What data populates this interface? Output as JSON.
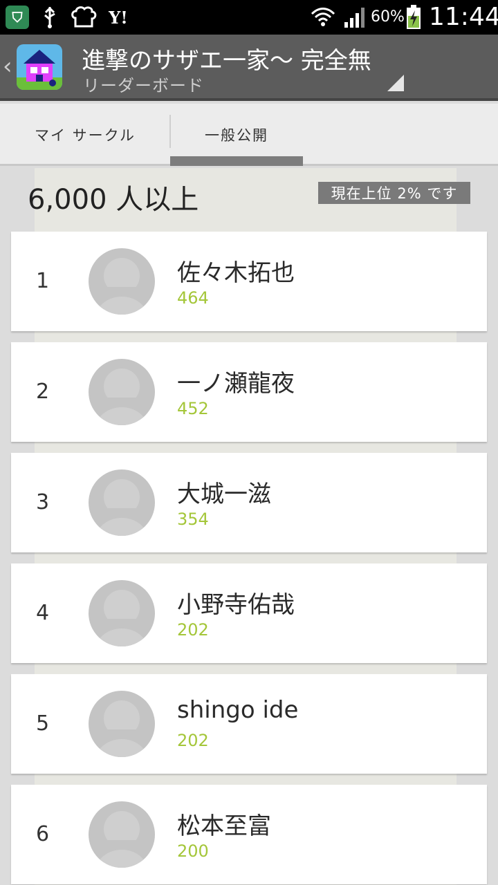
{
  "status_bar": {
    "icons": [
      "app-shield-icon",
      "usb-icon",
      "chef-hat-icon",
      "yahoo-icon",
      "wifi-icon",
      "signal-icon",
      "battery-charging-icon"
    ],
    "yahoo_text": "Y!",
    "battery_percent": "60%",
    "time": "11:44"
  },
  "action_bar": {
    "title": "進撃のサザエ一家～ 完全無",
    "subtitle": "リーダーボード",
    "back_glyph": "‹"
  },
  "tabs": [
    {
      "label": "マイ サークル",
      "selected": false
    },
    {
      "label": "一般公開",
      "selected": true
    }
  ],
  "summary": {
    "player_count": "6,000 人以上",
    "rank_badge": "現在上位 2% です"
  },
  "leaderboard": [
    {
      "rank": "1",
      "name": "佐々木拓也",
      "score": "464"
    },
    {
      "rank": "2",
      "name": "一ノ瀬龍夜",
      "score": "452"
    },
    {
      "rank": "3",
      "name": "大城一滋",
      "score": "354"
    },
    {
      "rank": "4",
      "name": "小野寺佑哉",
      "score": "202"
    },
    {
      "rank": "5",
      "name": "shingo ide",
      "score": "202"
    },
    {
      "rank": "6",
      "name": "松本至富",
      "score": "200"
    }
  ],
  "colors": {
    "score": "#a4c639",
    "action_bar": "#5c5c5c",
    "tab_indicator": "#7d7d7d"
  }
}
